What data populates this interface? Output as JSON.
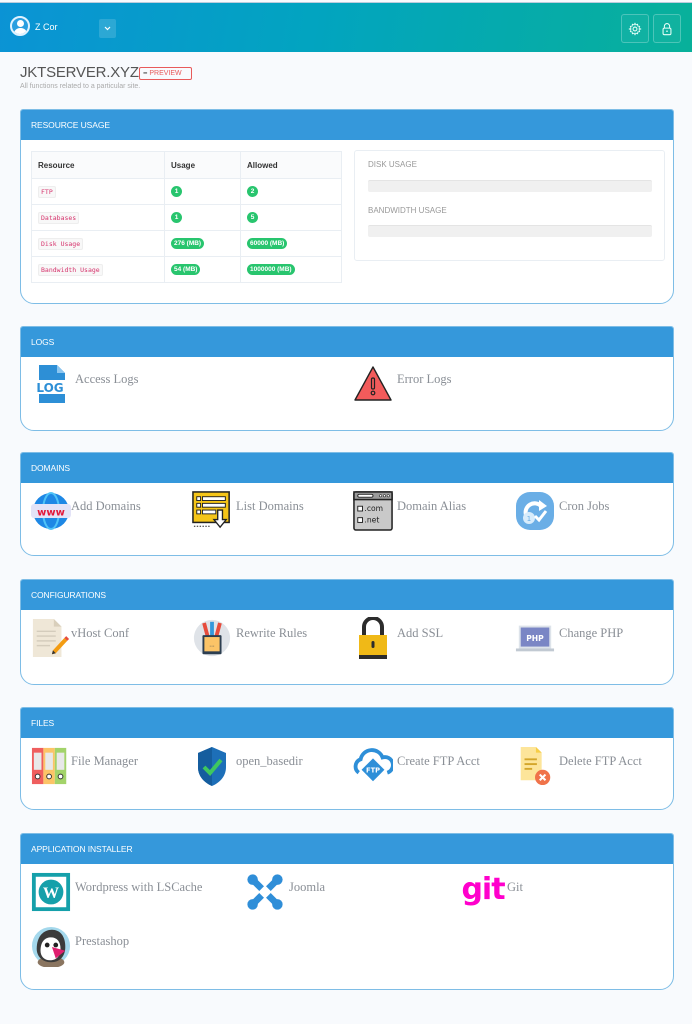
{
  "topbar": {
    "username": "Z Cor",
    "dropdown_icon": "chevron-down-icon",
    "settings_icon": "gear-icon",
    "lock_icon": "lock-icon"
  },
  "page": {
    "title": "JKTSERVER.XYZ -",
    "badge": "PREVIEW",
    "subtitle": "All functions related to a particular site."
  },
  "resource_usage": {
    "header": "RESOURCE USAGE",
    "columns": [
      "Resource",
      "Usage",
      "Allowed"
    ],
    "rows": [
      {
        "resource": "FTP",
        "usage": "1",
        "allowed": "2"
      },
      {
        "resource": "Databases",
        "usage": "1",
        "allowed": "5"
      },
      {
        "resource": "Disk Usage",
        "usage": "276 (MB)",
        "allowed": "60000 (MB)"
      },
      {
        "resource": "Bandwidth Usage",
        "usage": "54 (MB)",
        "allowed": "1000000 (MB)"
      }
    ],
    "disk_usage_label": "DISK USAGE",
    "disk_usage_percent": 0,
    "bandwidth_usage_label": "BANDWIDTH USAGE",
    "bandwidth_usage_percent": 0
  },
  "logs": {
    "header": "LOGS",
    "items": [
      {
        "label": "Access Logs",
        "icon": "log-file-icon"
      },
      {
        "label": "Error Logs",
        "icon": "warning-triangle-icon"
      }
    ]
  },
  "domains": {
    "header": "DOMAINS",
    "items": [
      {
        "label": "Add Domains",
        "icon": "www-globe-icon"
      },
      {
        "label": "List Domains",
        "icon": "list-download-icon"
      },
      {
        "label": "Domain Alias",
        "icon": "domain-alias-icon"
      },
      {
        "label": "Cron Jobs",
        "icon": "cron-icon"
      }
    ]
  },
  "configurations": {
    "header": "CONFIGURATIONS",
    "items": [
      {
        "label": "vHost Conf",
        "icon": "document-edit-icon"
      },
      {
        "label": "Rewrite Rules",
        "icon": "pencil-cup-icon"
      },
      {
        "label": "Add SSL",
        "icon": "padlock-icon"
      },
      {
        "label": "Change PHP",
        "icon": "php-laptop-icon"
      }
    ]
  },
  "files": {
    "header": "FILES",
    "items": [
      {
        "label": "File Manager",
        "icon": "binders-icon"
      },
      {
        "label": "open_basedir",
        "icon": "shield-check-icon"
      },
      {
        "label": "Create FTP Acct",
        "icon": "ftp-cloud-icon"
      },
      {
        "label": "Delete FTP Acct",
        "icon": "document-delete-icon"
      }
    ]
  },
  "app_installer": {
    "header": "APPLICATION INSTALLER",
    "items": [
      {
        "label": "Wordpress with LSCache",
        "icon": "wordpress-icon"
      },
      {
        "label": "Joomla",
        "icon": "joomla-icon"
      },
      {
        "label": "Git",
        "icon": "git-icon",
        "icon_text": "git"
      },
      {
        "label": "Prestashop",
        "icon": "prestashop-icon"
      }
    ]
  },
  "colors": {
    "panel_header": "#3598db",
    "badge": "#e85a5a",
    "pill": "#28c56e",
    "git": "#ff00cc"
  }
}
